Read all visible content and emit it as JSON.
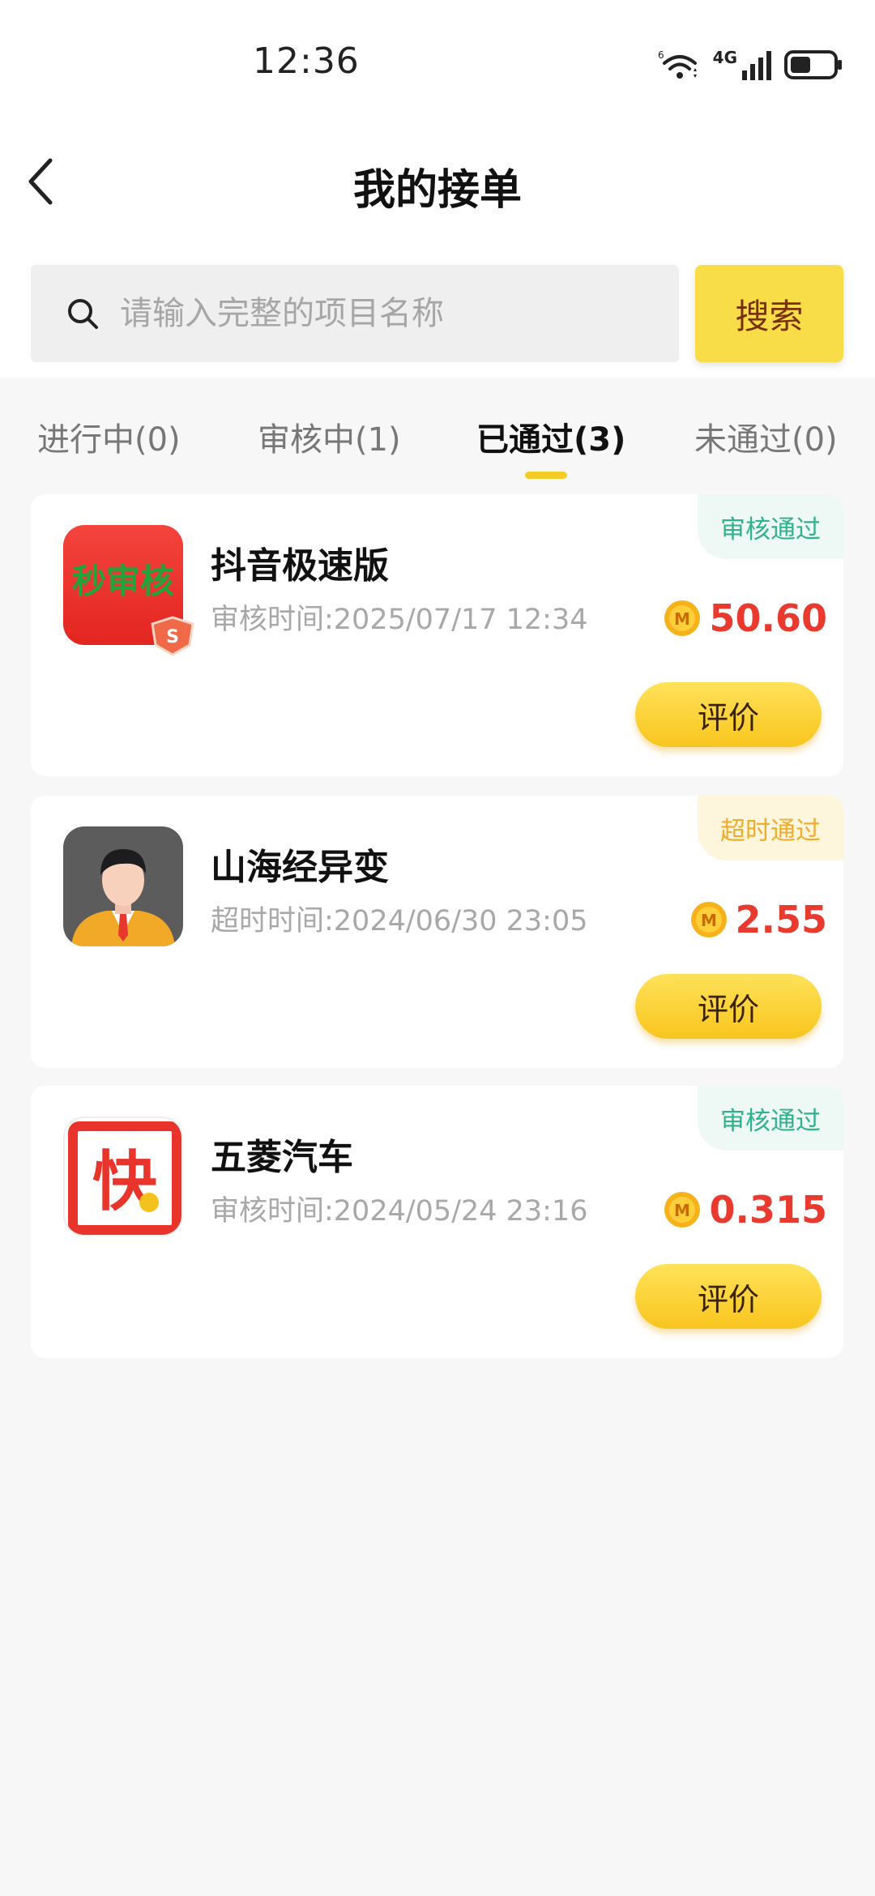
{
  "status_bar": {
    "time": "12:36",
    "net_label": "4G"
  },
  "header": {
    "title": "我的接单"
  },
  "search": {
    "placeholder": "请输入完整的项目名称",
    "button_label": "搜索"
  },
  "tabs": [
    {
      "label": "进行中(0)"
    },
    {
      "label": "审核中(1)"
    },
    {
      "label": "已通过(3)",
      "active": true
    },
    {
      "label": "未通过(0)"
    }
  ],
  "orders": [
    {
      "name": "抖音极速版",
      "time_text": "审核时间:2025/07/17 12:34",
      "status": "审核通过",
      "amount": "50.60",
      "review_label": "评价",
      "icon": "秒审核",
      "icon_name": "miao-shenhe-app-icon"
    },
    {
      "name": "山海经异变",
      "time_text": "超时时间:2024/06/30 23:05",
      "status": "超时通过",
      "amount": "2.55",
      "review_label": "评价",
      "icon_name": "user-avatar-icon"
    },
    {
      "name": "五菱汽车",
      "time_text": "审核时间:2024/05/24 23:16",
      "status": "审核通过",
      "amount": "0.315",
      "review_label": "评价",
      "icon": "快",
      "icon_name": "kuai-app-icon"
    }
  ],
  "colors": {
    "accent_yellow": "#f8dd48",
    "amount_red": "#e83a2f",
    "badge_green": "#30b28c",
    "badge_orange": "#f0ac2c"
  }
}
